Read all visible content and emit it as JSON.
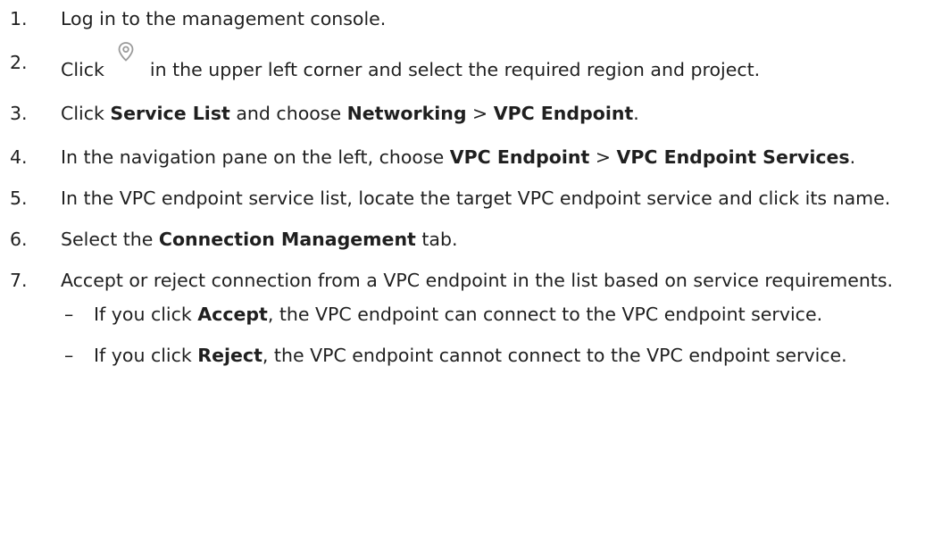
{
  "steps": [
    {
      "num": "1.",
      "text": "Log in to the management console."
    },
    {
      "num": "2.",
      "pre": "Click ",
      "icon": "location-pin-icon",
      "post": " in the upper left corner and select the required region and project."
    },
    {
      "num": "3.",
      "t1": "Click ",
      "b1": "Service List",
      "t2": " and choose ",
      "b2": "Networking",
      "t3": " > ",
      "b3": "VPC Endpoint",
      "t4": "."
    },
    {
      "num": "4.",
      "t1": "In the navigation pane on the left, choose ",
      "b1": "VPC Endpoint",
      "t2": " > ",
      "b2": "VPC Endpoint Services",
      "t3": "."
    },
    {
      "num": "5.",
      "text": "In the VPC endpoint service list, locate the target VPC endpoint service and click its name."
    },
    {
      "num": "6.",
      "t1": "Select the ",
      "b1": "Connection Management",
      "t2": " tab."
    },
    {
      "num": "7.",
      "text": "Accept or reject connection from a VPC endpoint in the list based on service requirements."
    }
  ],
  "sub_items": [
    {
      "dash": "–",
      "t1": "If you click ",
      "b1": "Accept",
      "t2": ", the VPC endpoint can connect to the VPC endpoint service."
    },
    {
      "dash": "–",
      "t1": "If you click ",
      "b1": "Reject",
      "t2": ", the VPC endpoint cannot connect to the VPC endpoint service."
    }
  ]
}
